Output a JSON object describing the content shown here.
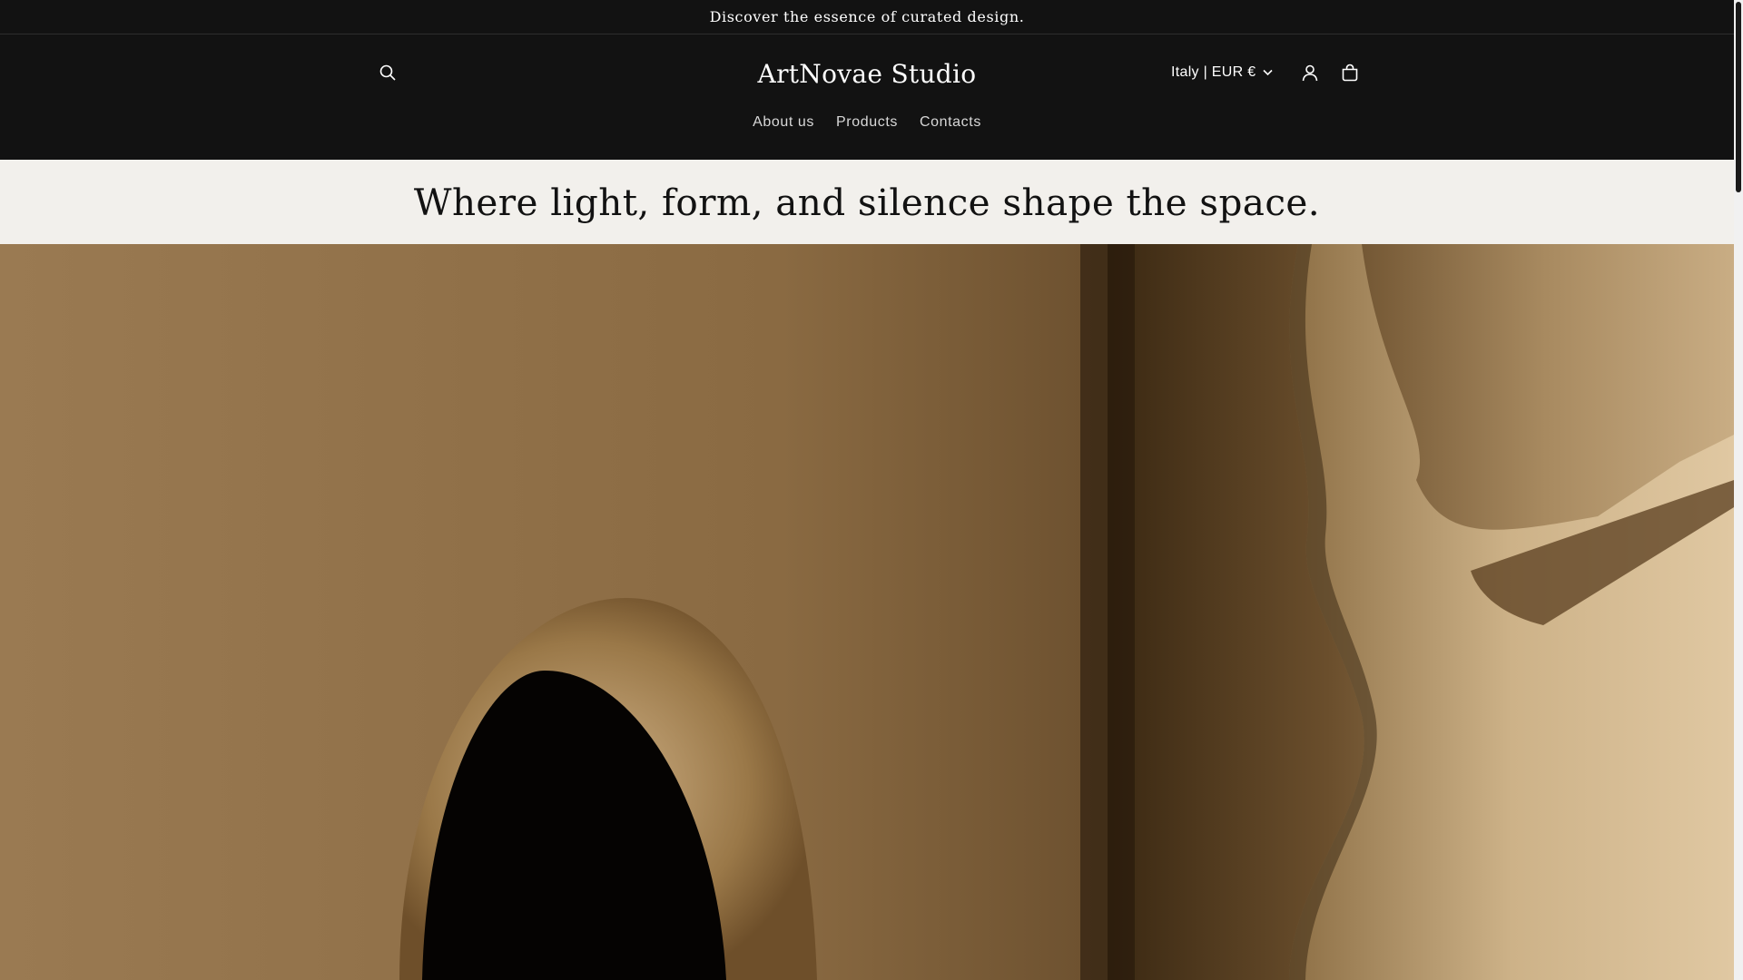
{
  "announcement": {
    "text": "Discover the essence of curated design."
  },
  "header": {
    "logo": "ArtNovae Studio",
    "locale": "Italy | EUR €",
    "icons": {
      "search": "search-icon",
      "account": "account-icon",
      "cart": "cart-icon",
      "locale_chevron": "chevron-down-icon"
    }
  },
  "nav": {
    "items": [
      {
        "label": "About us"
      },
      {
        "label": "Products"
      },
      {
        "label": "Contacts"
      }
    ]
  },
  "tagline": {
    "text": "Where light, form, and silence shape the space."
  },
  "colors": {
    "header_bg": "#121212",
    "header_text": "#ffffff",
    "tagline_bg": "#f2f0ec",
    "hero_tone": "#7a5a36"
  }
}
